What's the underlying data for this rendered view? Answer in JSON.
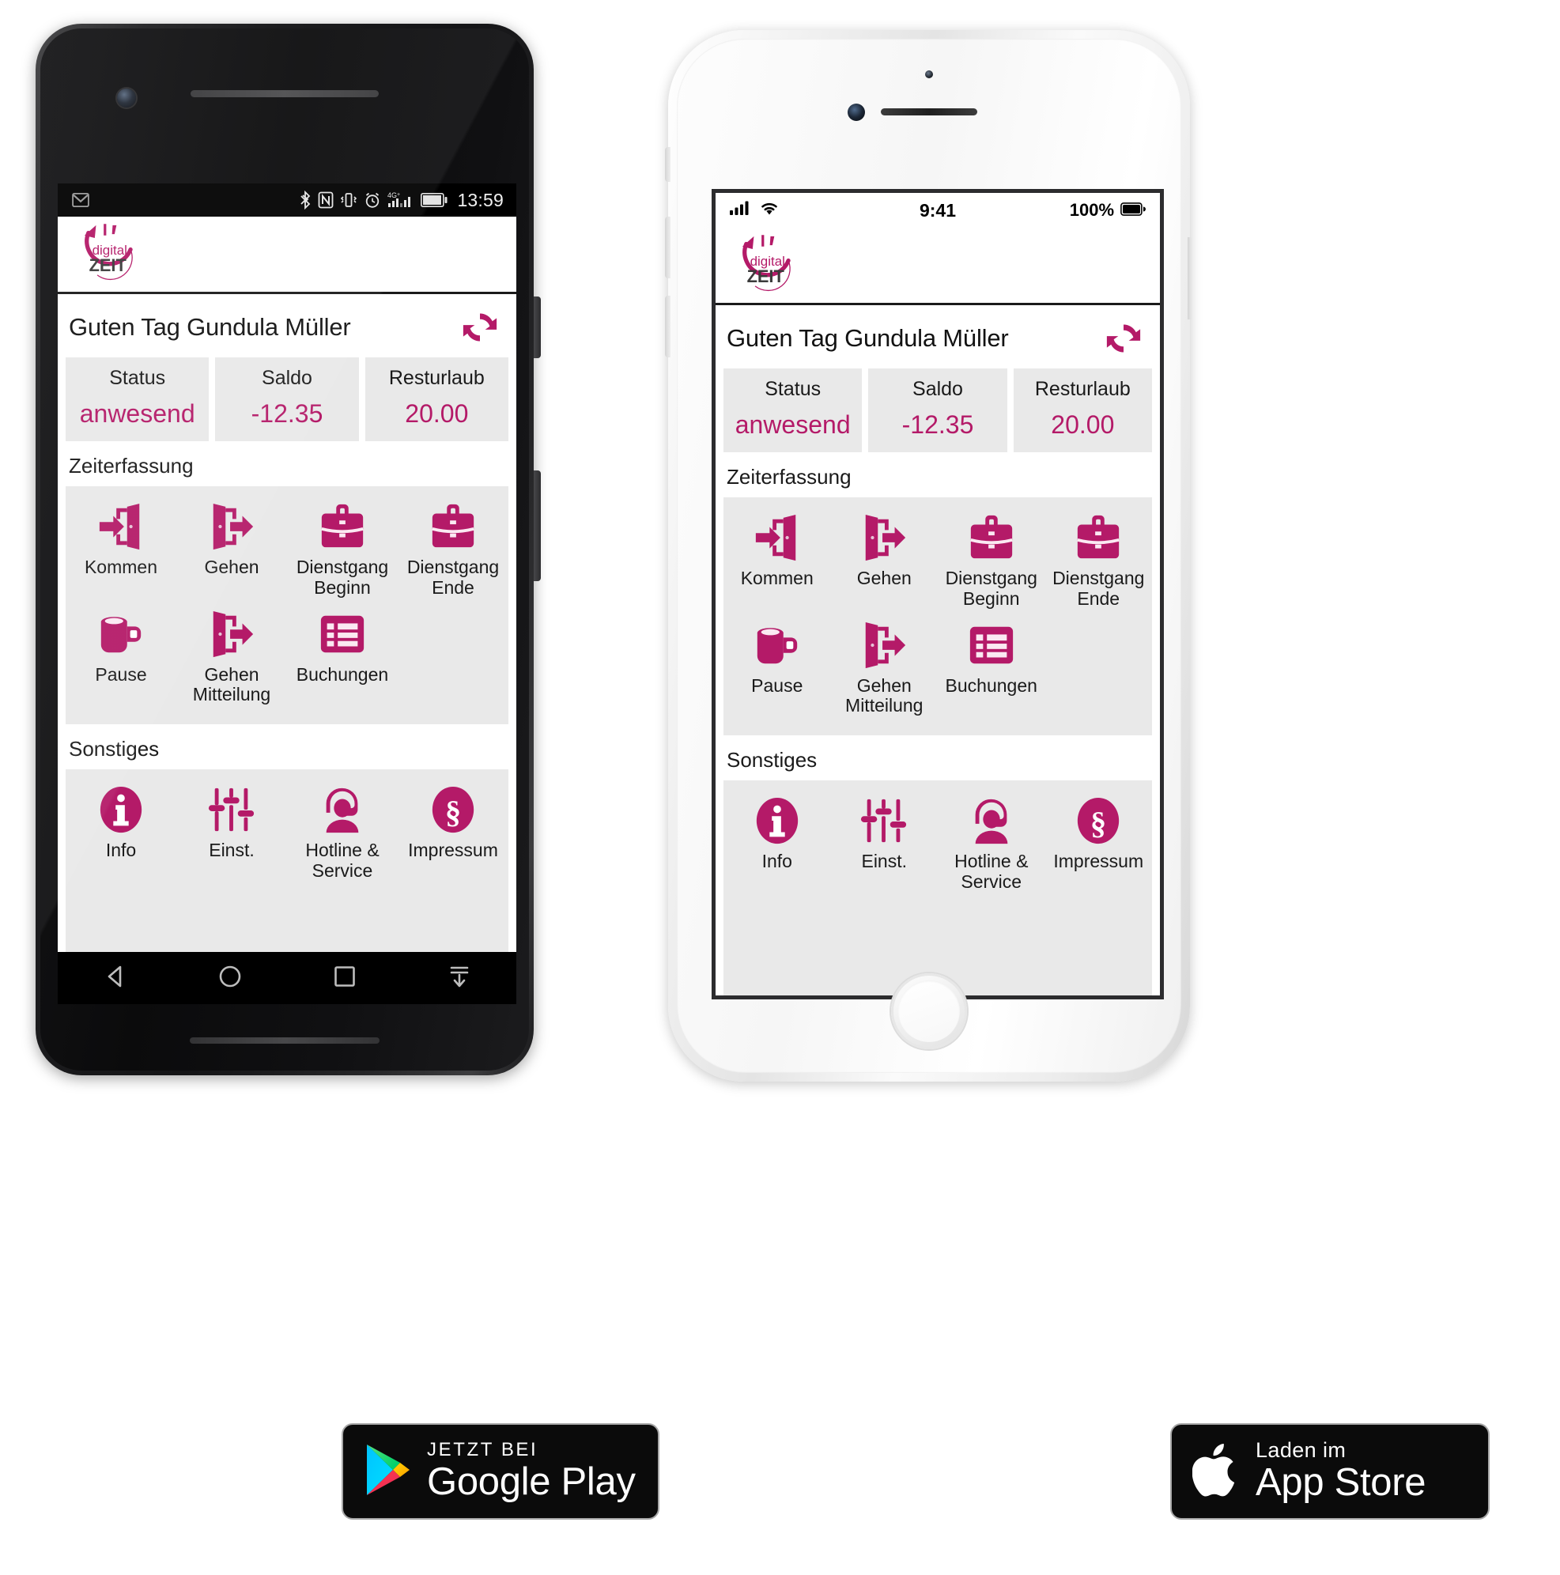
{
  "brand": {
    "magenta": "#b41a68",
    "dark": "#3b3b3b",
    "logo_word_top": "digital",
    "logo_word_bottom": "ZEIT"
  },
  "android": {
    "statusbar": {
      "left_icons": [
        "gmail-icon"
      ],
      "right_icons": [
        "bluetooth-icon",
        "nfc-icon",
        "vibrate-icon",
        "alarm-icon",
        "signal-4g-icon",
        "battery-icon"
      ],
      "network_label": "4G+",
      "time": "13:59"
    },
    "navbar": {
      "items": [
        "back-icon",
        "home-icon",
        "recents-icon",
        "hide-navbar-icon"
      ]
    }
  },
  "ios": {
    "statusbar": {
      "signal": "signal-bars-icon",
      "wifi": "wifi-icon",
      "time": "9:41",
      "battery_percent": "100%",
      "battery": "battery-icon"
    }
  },
  "app": {
    "greeting": "Guten Tag Gundula Müller",
    "refresh_icon": "refresh-icon",
    "cards": [
      {
        "label": "Status",
        "value": "anwesend"
      },
      {
        "label": "Saldo",
        "value": "-12.35"
      },
      {
        "label": "Resturlaub",
        "value": "20.00"
      }
    ],
    "sections": [
      {
        "title": "Zeiterfassung",
        "rows": [
          [
            {
              "label": "Kommen",
              "icon": "door-enter-icon"
            },
            {
              "label": "Gehen",
              "icon": "door-exit-icon"
            },
            {
              "label": "Dienstgang\nBeginn",
              "label_l1": "Dienstgang",
              "label_l2": "Beginn",
              "icon": "briefcase-icon"
            },
            {
              "label": "Dienstgang\nEnde",
              "label_l1": "Dienstgang",
              "label_l2": "Ende",
              "icon": "briefcase-icon"
            }
          ],
          [
            {
              "label": "Pause",
              "label_l1": "Pause",
              "label_l2": "",
              "icon": "coffee-mug-icon"
            },
            {
              "label": "Gehen\nMitteilung",
              "label_l1": "Gehen",
              "label_l2": "Mitteilung",
              "icon": "door-exit-icon"
            },
            {
              "label": "Buchungen",
              "label_l1": "Buchungen",
              "label_l2": "",
              "icon": "list-icon"
            },
            {
              "label": "",
              "label_l1": "",
              "label_l2": "",
              "icon": ""
            }
          ]
        ]
      },
      {
        "title": "Sonstiges",
        "rows": [
          [
            {
              "label": "Info",
              "label_l1": "Info",
              "label_l2": "",
              "icon": "info-circle-icon"
            },
            {
              "label": "Einst.",
              "label_l1": "Einst.",
              "label_l2": "",
              "icon": "sliders-icon"
            },
            {
              "label": "Hotline &\nService",
              "label_l1": "Hotline &",
              "label_l2": "Service",
              "icon": "headset-person-icon"
            },
            {
              "label": "Impressum",
              "label_l1": "Impressum",
              "label_l2": "",
              "icon": "paragraph-circle-icon"
            }
          ]
        ]
      }
    ]
  },
  "badges": {
    "google_play": {
      "small": "JETZT BEI",
      "big": "Google Play",
      "icon": "google-play-icon"
    },
    "app_store": {
      "small": "Laden im",
      "big": "App Store",
      "icon": "apple-icon"
    }
  }
}
